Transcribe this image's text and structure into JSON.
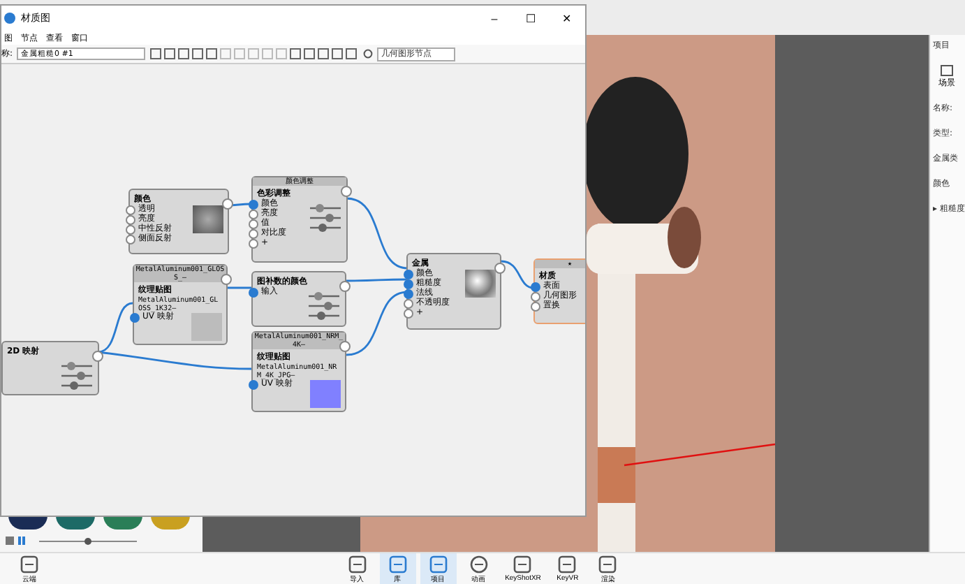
{
  "window": {
    "title": "材质图",
    "controls": [
      "–",
      "☐",
      "✕"
    ]
  },
  "menu": [
    "图",
    "节点",
    "查看",
    "窗口"
  ],
  "toolbar": {
    "name_label": "称:",
    "name_value": "金属粗糙0 #1",
    "search_placeholder": "几何图形节点"
  },
  "nodes": [
    {
      "kind": "swatch",
      "title": "颜色",
      "ports": [
        {
          "label": "透明",
          "connected": false
        },
        {
          "label": "亮度",
          "connected": false
        },
        {
          "label": "中性反射",
          "connected": false
        },
        {
          "label": "侧面反射",
          "connected": false
        }
      ]
    },
    {
      "kind": "sliders",
      "header": "颜色调整",
      "title": "色彩调整",
      "ports": [
        {
          "label": "颜色",
          "connected": true
        },
        {
          "label": "亮度",
          "connected": false
        },
        {
          "label": "值",
          "connected": false
        },
        {
          "label": "对比度",
          "connected": false
        },
        {
          "label": "+",
          "connected": false
        }
      ]
    },
    {
      "kind": "texture",
      "header": "MetalAluminum001_GLOSS_—",
      "title": "纹理贴图",
      "detail": "MetalAluminum001_GLOSS_1K32—",
      "ports": [
        {
          "label": "UV 映射",
          "connected": true
        }
      ]
    },
    {
      "kind": "sliders",
      "title": "图补数的颜色",
      "ports": [
        {
          "label": "输入",
          "connected": true
        }
      ]
    },
    {
      "kind": "texture",
      "header": "MetalAluminum001_NRM_4K—",
      "title": "纹理贴图",
      "detail": "MetalAluminum001_NRM_4K_JPG—",
      "ports": [
        {
          "label": "UV 映射",
          "connected": true
        }
      ]
    },
    {
      "kind": "sphere",
      "title": "金属",
      "ports": [
        {
          "label": "颜色",
          "connected": true
        },
        {
          "label": "粗糙度",
          "connected": true
        },
        {
          "label": "法线",
          "connected": true
        },
        {
          "label": "不透明度",
          "connected": false
        },
        {
          "label": "+",
          "connected": false
        }
      ]
    },
    {
      "kind": "output",
      "header": "★",
      "title": "材质",
      "ports": [
        {
          "label": "表面",
          "connected": true
        },
        {
          "label": "几何图形",
          "connected": false
        },
        {
          "label": "置换",
          "connected": false
        }
      ]
    },
    {
      "kind": "sliders",
      "title": "2D 映射"
    }
  ],
  "library": {
    "zoom": {
      "level": 0.5
    }
  },
  "right_panel": {
    "tab": "项目",
    "scene_button": "场景",
    "fields": [
      "名称:",
      "类型:",
      "金属类",
      "颜色",
      "▸ 粗糙度"
    ]
  },
  "dock": [
    {
      "label": "云端",
      "selected": false
    },
    {
      "label": "导入",
      "selected": false
    },
    {
      "label": "库",
      "selected": true
    },
    {
      "label": "项目",
      "selected": true
    },
    {
      "label": "动画",
      "selected": false
    },
    {
      "label": "KeyShotXR",
      "selected": false
    },
    {
      "label": "KeyVR",
      "selected": false
    },
    {
      "label": "渲染",
      "selected": false
    }
  ]
}
